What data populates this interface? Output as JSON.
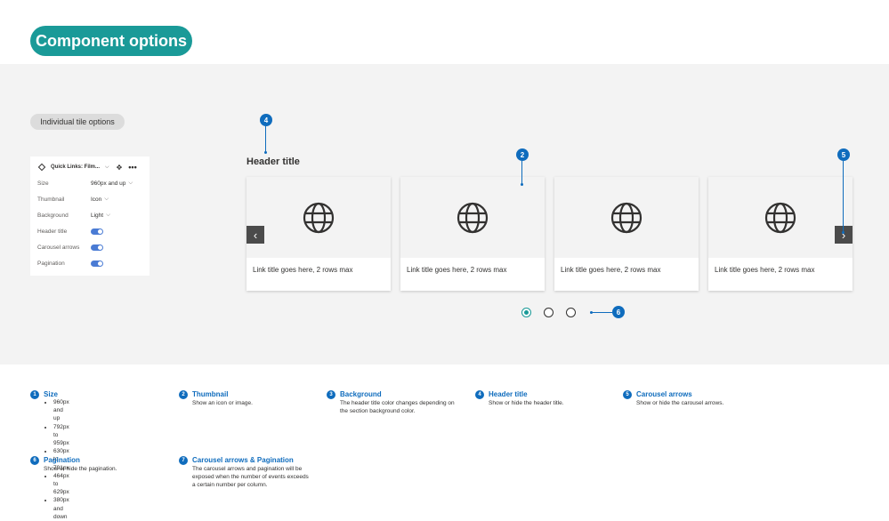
{
  "page_title": "Component options",
  "section_label": "Individual tile options",
  "panel": {
    "title": "Quick Links: Film...",
    "rows": [
      {
        "label": "Size",
        "value": "960px and up"
      },
      {
        "label": "Thumbnail",
        "value": "Icon"
      },
      {
        "label": "Background",
        "value": "Light"
      },
      {
        "label": "Header title",
        "toggle": true
      },
      {
        "label": "Carousel arrows",
        "toggle": true
      },
      {
        "label": "Pagination",
        "toggle": true
      }
    ]
  },
  "preview": {
    "header_title": "Header title",
    "cards": [
      {
        "title": "Link title goes here, 2 rows max",
        "icon": "globe-icon"
      },
      {
        "title": "Link title goes here, 2 rows max",
        "icon": "globe-icon"
      },
      {
        "title": "Link title goes here, 2 rows max",
        "icon": "globe-icon"
      },
      {
        "title": "Link title goes here, 2 rows max",
        "icon": "globe-icon"
      }
    ],
    "pagination": {
      "pages": 3,
      "active": 1
    },
    "markers": [
      "4",
      "2",
      "5",
      "6"
    ]
  },
  "colors": {
    "accent": "#1a9a98",
    "marker": "#0f6cbd",
    "canvas": "#f3f3f3"
  },
  "legend": [
    {
      "num": "1",
      "title": "Size",
      "items": [
        "960px and up",
        "792px to 959px",
        "630px to 791px",
        "464px to 629px",
        "380px and down"
      ]
    },
    {
      "num": "2",
      "title": "Thumbnail",
      "desc": "Show an icon or image."
    },
    {
      "num": "3",
      "title": "Background",
      "desc": "The header title color changes depending on the section background color."
    },
    {
      "num": "4",
      "title": "Header title",
      "desc": "Show or hide the header title."
    },
    {
      "num": "5",
      "title": "Carousel arrows",
      "desc": "Show or hide the carousel arrows."
    },
    {
      "num": "6",
      "title": "Pagination",
      "desc": "Show or hide the pagination."
    },
    {
      "num": "7",
      "title": "Carousel arrows & Pagination",
      "desc": "The carousel arrows and pagination will be exposed when the number of events exceeds a certain number per column."
    }
  ]
}
